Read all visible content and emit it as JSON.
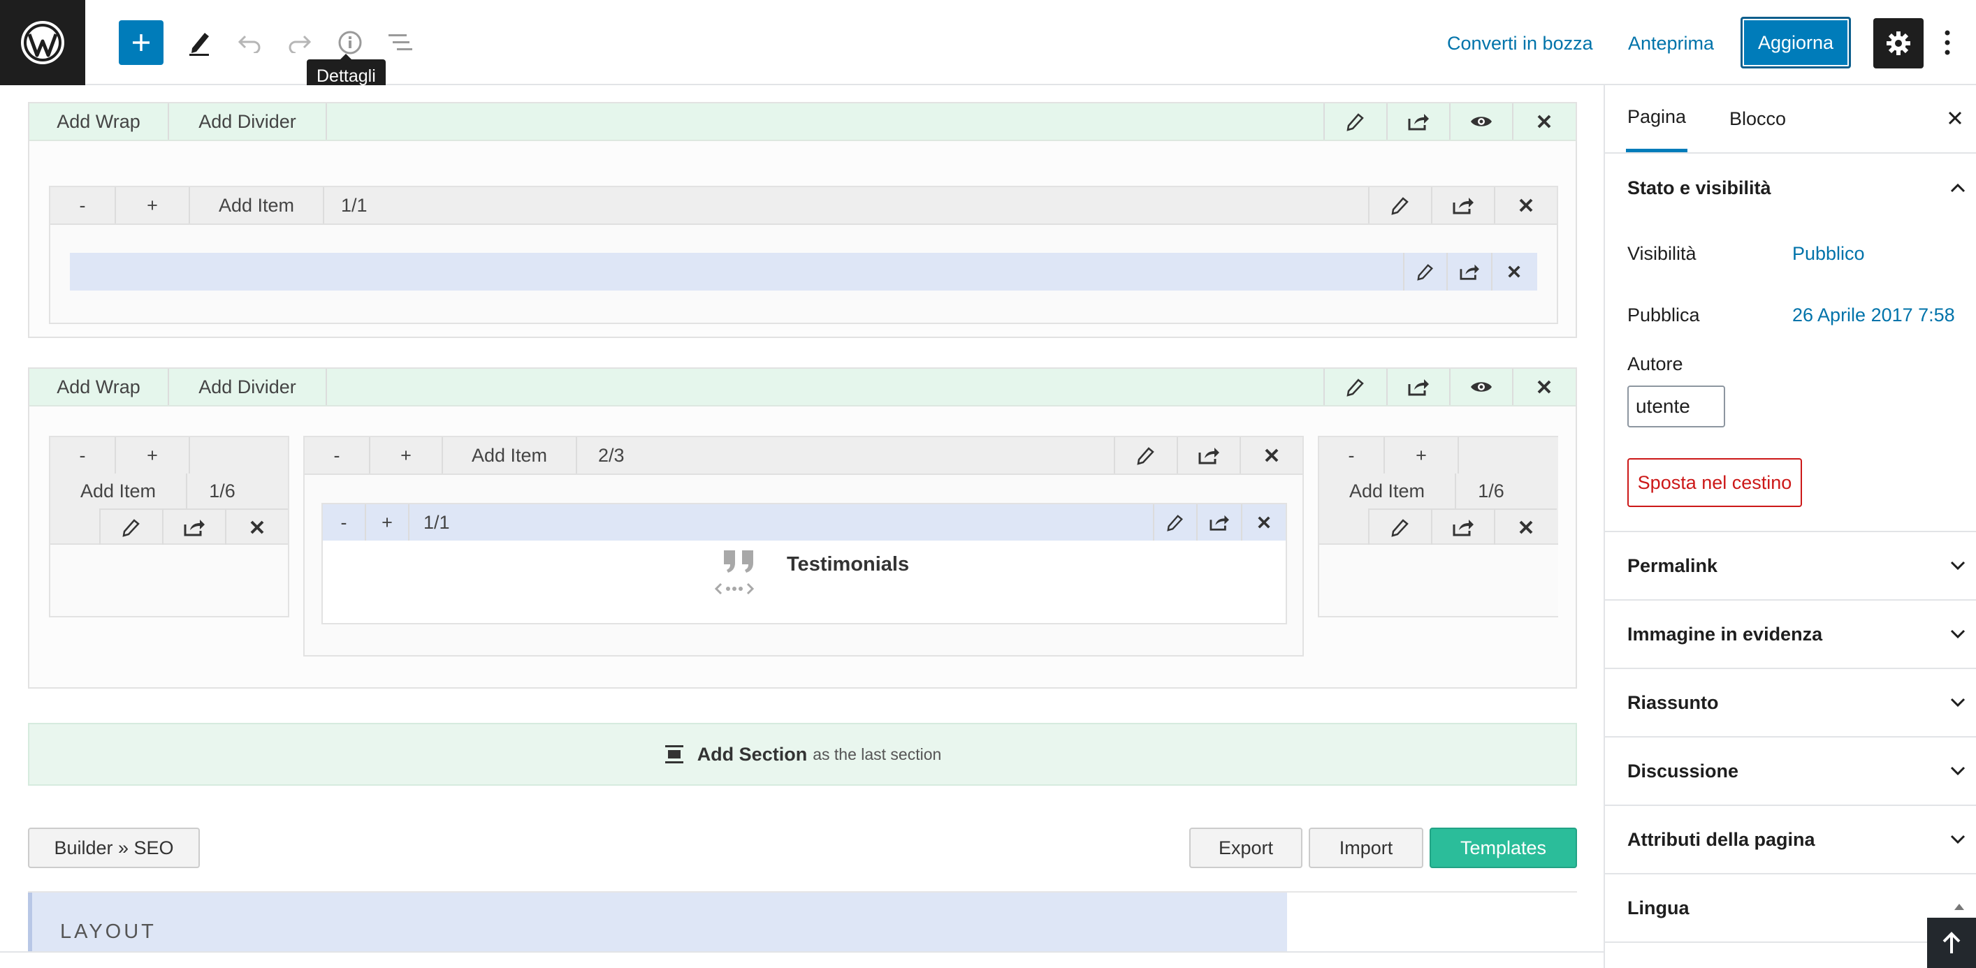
{
  "toolbar": {
    "tooltip": "Dettagli",
    "convert_draft": "Converti in bozza",
    "preview": "Anteprima",
    "update": "Aggiorna"
  },
  "sections": [
    {
      "add_wrap": "Add Wrap",
      "add_divider": "Add Divider",
      "wraps": [
        {
          "minus": "-",
          "plus": "+",
          "add_item": "Add Item",
          "size": "1/1"
        }
      ]
    },
    {
      "add_wrap": "Add Wrap",
      "add_divider": "Add Divider",
      "wraps": [
        {
          "minus": "-",
          "plus": "+",
          "add_item": "Add Item",
          "size": "1/6"
        },
        {
          "minus": "-",
          "plus": "+",
          "add_item": "Add Item",
          "size": "2/3",
          "item": {
            "minus": "-",
            "plus": "+",
            "size": "1/1",
            "title": "Testimonials"
          }
        },
        {
          "minus": "-",
          "plus": "+",
          "add_item": "Add Item",
          "size": "1/6"
        }
      ]
    }
  ],
  "add_section": {
    "label": "Add Section",
    "suffix": "as the last section"
  },
  "builder_buttons": {
    "seo": "Builder » SEO",
    "export": "Export",
    "import": "Import",
    "templates": "Templates"
  },
  "layout_panel": {
    "tab": "LAYOUT"
  },
  "sidebar": {
    "tabs": [
      "Pagina",
      "Blocco"
    ],
    "status_panel": {
      "title": "Stato e visibilità",
      "visibility_label": "Visibilità",
      "visibility_value": "Pubblico",
      "publish_label": "Pubblica",
      "publish_value": "26 Aprile 2017 7:58",
      "author_label": "Autore",
      "author_value": "utente",
      "trash": "Sposta nel cestino"
    },
    "panels": [
      "Permalink",
      "Immagine in evidenza",
      "Riassunto",
      "Discussione",
      "Attributi della pagina",
      "Lingua"
    ]
  },
  "colors": {
    "wp_blue": "#007cba",
    "link": "#0073aa",
    "section_bar": "#e5f6ec",
    "item_bar": "#dee6f6",
    "templates": "#2bbd9a",
    "danger": "#cc1818"
  }
}
